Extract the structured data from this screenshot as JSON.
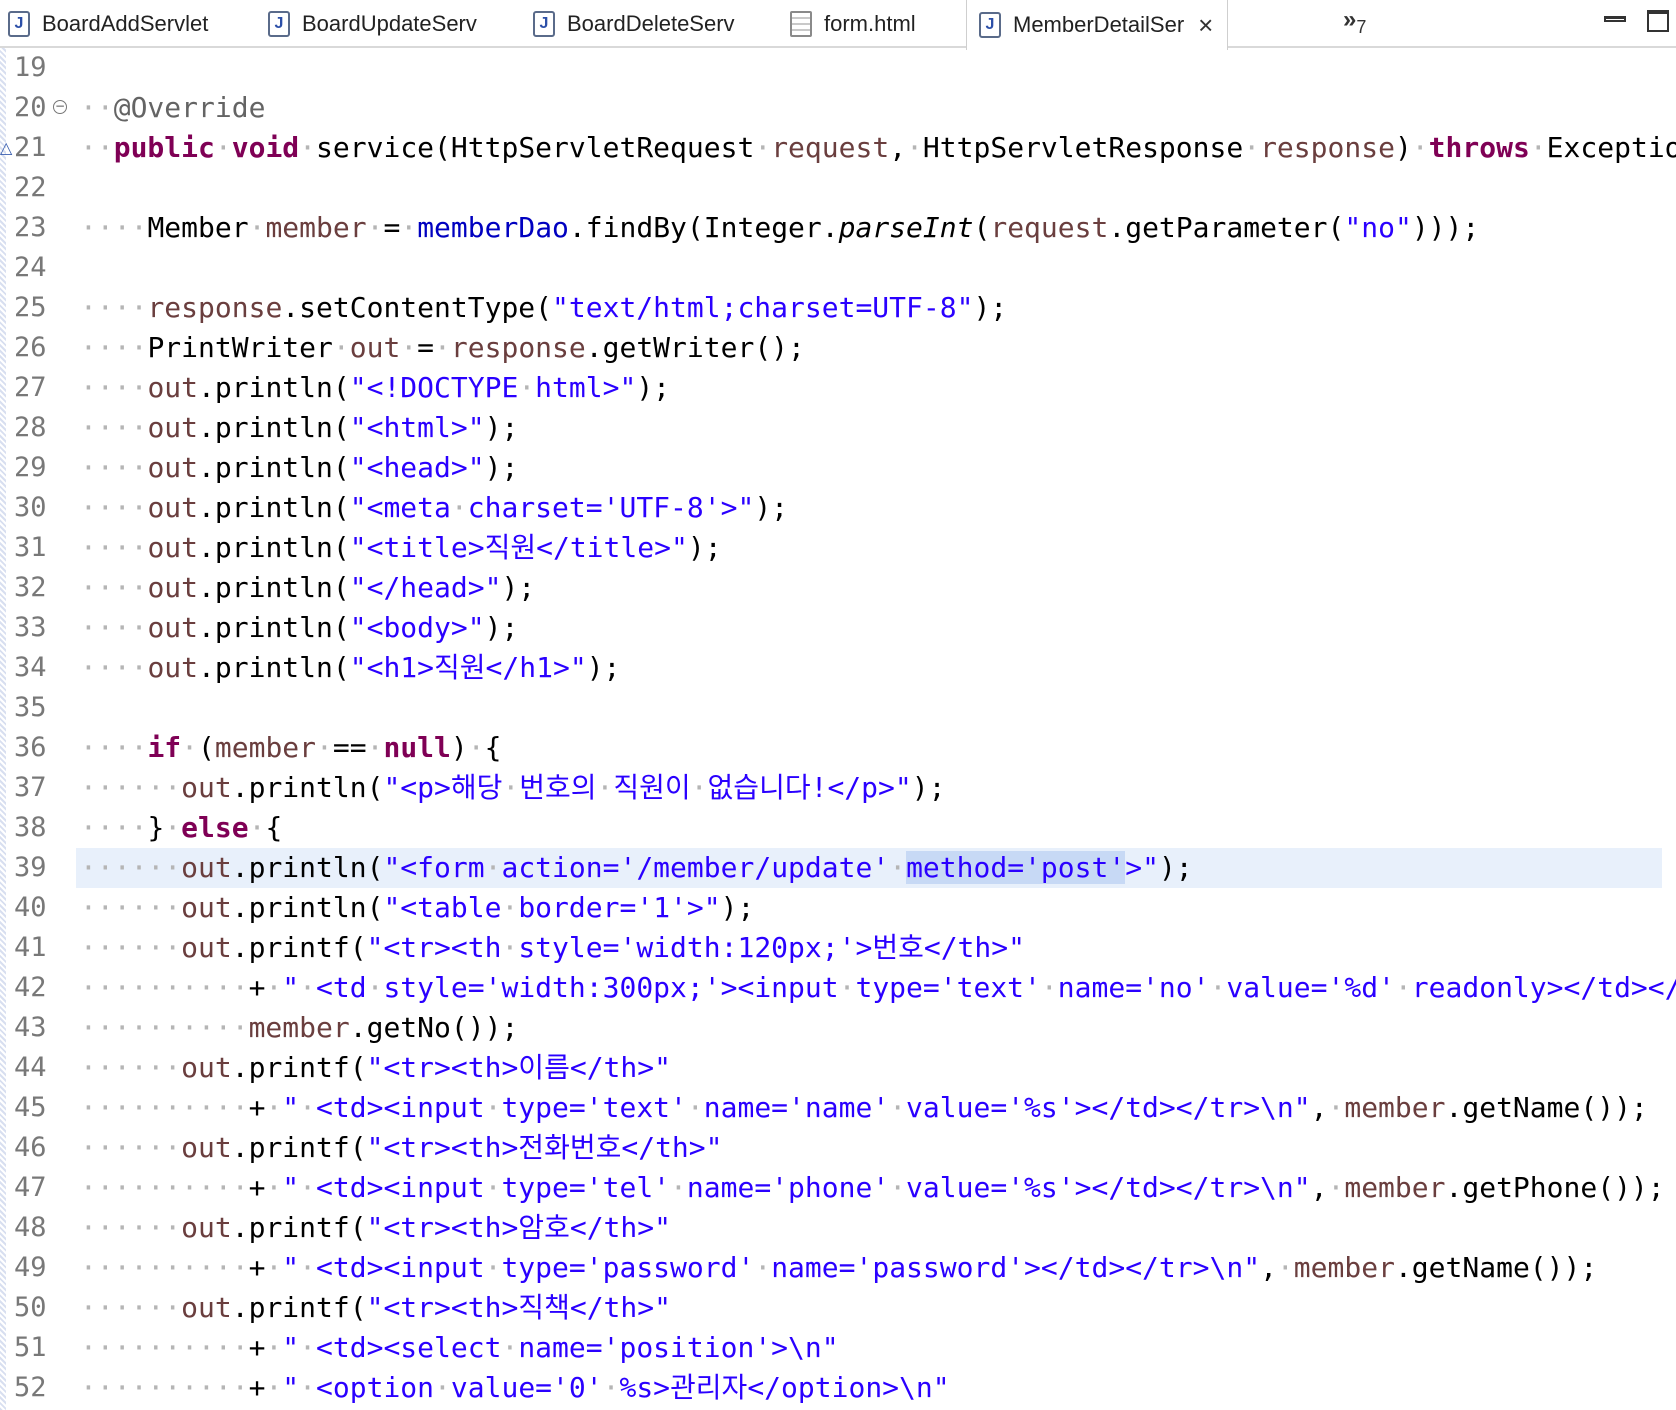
{
  "tabs": [
    {
      "label": "BoardAddServlet",
      "icon": "java-file-icon",
      "active": false
    },
    {
      "label": "BoardUpdateServ",
      "icon": "java-file-icon",
      "active": false
    },
    {
      "label": "BoardDeleteServ",
      "icon": "java-file-icon",
      "active": false
    },
    {
      "label": "form.html",
      "icon": "html-file-icon",
      "active": false
    },
    {
      "label": "MemberDetailSer",
      "icon": "java-file-icon",
      "active": true
    }
  ],
  "tab_overflow": {
    "symbol": "»",
    "count": "7"
  },
  "window_controls": {
    "close_symbol": "×"
  },
  "colors": {
    "keyword": "#7f0055",
    "string": "#2a00ff",
    "field": "#0000c0",
    "local_var": "#6a3e3e",
    "annotation": "#646464",
    "current_line": "#e8f0fb"
  },
  "lines": [
    {
      "n": "19",
      "tokens": []
    },
    {
      "n": "20",
      "tokens": [
        [
          "ws",
          "··"
        ],
        [
          "ann",
          "@Override"
        ]
      ]
    },
    {
      "n": "21",
      "tokens": [
        [
          "ws",
          "··"
        ],
        [
          "kw",
          "public"
        ],
        [
          "ws",
          "·"
        ],
        [
          "kw",
          "void"
        ],
        [
          "ws",
          "·"
        ],
        [
          "p",
          "service(HttpServletRequest"
        ],
        [
          "ws",
          "·"
        ],
        [
          "var",
          "request"
        ],
        [
          "p",
          ","
        ],
        [
          "ws",
          "·"
        ],
        [
          "p",
          "HttpServletResponse"
        ],
        [
          "ws",
          "·"
        ],
        [
          "var",
          "response"
        ],
        [
          "p",
          ")"
        ],
        [
          "ws",
          "·"
        ],
        [
          "kw",
          "throws"
        ],
        [
          "ws",
          "·"
        ],
        [
          "p",
          "Exception"
        ],
        [
          "ws",
          "·"
        ],
        [
          "p",
          "{"
        ]
      ]
    },
    {
      "n": "22",
      "tokens": []
    },
    {
      "n": "23",
      "tokens": [
        [
          "ws",
          "····"
        ],
        [
          "p",
          "Member"
        ],
        [
          "ws",
          "·"
        ],
        [
          "var",
          "member"
        ],
        [
          "ws",
          "·"
        ],
        [
          "p",
          "="
        ],
        [
          "ws",
          "·"
        ],
        [
          "fld",
          "memberDao"
        ],
        [
          "p",
          ".findBy(Integer."
        ],
        [
          "ital",
          "parseInt"
        ],
        [
          "p",
          "("
        ],
        [
          "var",
          "request"
        ],
        [
          "p",
          ".getParameter("
        ],
        [
          "str",
          "\"no\""
        ],
        [
          "p",
          ")));"
        ]
      ]
    },
    {
      "n": "24",
      "tokens": []
    },
    {
      "n": "25",
      "tokens": [
        [
          "ws",
          "····"
        ],
        [
          "var",
          "response"
        ],
        [
          "p",
          ".setContentType("
        ],
        [
          "str",
          "\"text/html;charset=UTF-8\""
        ],
        [
          "p",
          ");"
        ]
      ]
    },
    {
      "n": "26",
      "tokens": [
        [
          "ws",
          "····"
        ],
        [
          "p",
          "PrintWriter"
        ],
        [
          "ws",
          "·"
        ],
        [
          "var",
          "out"
        ],
        [
          "ws",
          "·"
        ],
        [
          "p",
          "="
        ],
        [
          "ws",
          "·"
        ],
        [
          "var",
          "response"
        ],
        [
          "p",
          ".getWriter();"
        ]
      ]
    },
    {
      "n": "27",
      "tokens": [
        [
          "ws",
          "····"
        ],
        [
          "var",
          "out"
        ],
        [
          "p",
          ".println("
        ],
        [
          "str",
          "\"<!DOCTYPE"
        ],
        [
          "ws",
          "·"
        ],
        [
          "str",
          "html>\""
        ],
        [
          "p",
          ");"
        ]
      ]
    },
    {
      "n": "28",
      "tokens": [
        [
          "ws",
          "····"
        ],
        [
          "var",
          "out"
        ],
        [
          "p",
          ".println("
        ],
        [
          "str",
          "\"<html>\""
        ],
        [
          "p",
          ");"
        ]
      ]
    },
    {
      "n": "29",
      "tokens": [
        [
          "ws",
          "····"
        ],
        [
          "var",
          "out"
        ],
        [
          "p",
          ".println("
        ],
        [
          "str",
          "\"<head>\""
        ],
        [
          "p",
          ");"
        ]
      ]
    },
    {
      "n": "30",
      "tokens": [
        [
          "ws",
          "····"
        ],
        [
          "var",
          "out"
        ],
        [
          "p",
          ".println("
        ],
        [
          "str",
          "\"<meta"
        ],
        [
          "ws",
          "·"
        ],
        [
          "str",
          "charset='UTF-8'>\""
        ],
        [
          "p",
          ");"
        ]
      ]
    },
    {
      "n": "31",
      "tokens": [
        [
          "ws",
          "····"
        ],
        [
          "var",
          "out"
        ],
        [
          "p",
          ".println("
        ],
        [
          "str",
          "\"<title>직원</title>\""
        ],
        [
          "p",
          ");"
        ]
      ]
    },
    {
      "n": "32",
      "tokens": [
        [
          "ws",
          "····"
        ],
        [
          "var",
          "out"
        ],
        [
          "p",
          ".println("
        ],
        [
          "str",
          "\"</head>\""
        ],
        [
          "p",
          ");"
        ]
      ]
    },
    {
      "n": "33",
      "tokens": [
        [
          "ws",
          "····"
        ],
        [
          "var",
          "out"
        ],
        [
          "p",
          ".println("
        ],
        [
          "str",
          "\"<body>\""
        ],
        [
          "p",
          ");"
        ]
      ]
    },
    {
      "n": "34",
      "tokens": [
        [
          "ws",
          "····"
        ],
        [
          "var",
          "out"
        ],
        [
          "p",
          ".println("
        ],
        [
          "str",
          "\"<h1>직원</h1>\""
        ],
        [
          "p",
          ");"
        ]
      ]
    },
    {
      "n": "35",
      "tokens": []
    },
    {
      "n": "36",
      "tokens": [
        [
          "ws",
          "····"
        ],
        [
          "kw",
          "if"
        ],
        [
          "ws",
          "·"
        ],
        [
          "p",
          "("
        ],
        [
          "var",
          "member"
        ],
        [
          "ws",
          "·"
        ],
        [
          "p",
          "=="
        ],
        [
          "ws",
          "·"
        ],
        [
          "kw",
          "null"
        ],
        [
          "p",
          ")"
        ],
        [
          "ws",
          "·"
        ],
        [
          "p",
          "{"
        ]
      ]
    },
    {
      "n": "37",
      "tokens": [
        [
          "ws",
          "······"
        ],
        [
          "var",
          "out"
        ],
        [
          "p",
          ".println("
        ],
        [
          "str",
          "\"<p>해당"
        ],
        [
          "ws",
          "·"
        ],
        [
          "str",
          "번호의"
        ],
        [
          "ws",
          "·"
        ],
        [
          "str",
          "직원이"
        ],
        [
          "ws",
          "·"
        ],
        [
          "str",
          "없습니다!</p>\""
        ],
        [
          "p",
          ");"
        ]
      ]
    },
    {
      "n": "38",
      "tokens": [
        [
          "ws",
          "····"
        ],
        [
          "p",
          "}"
        ],
        [
          "ws",
          "·"
        ],
        [
          "kw",
          "else"
        ],
        [
          "ws",
          "·"
        ],
        [
          "p",
          "{"
        ]
      ]
    },
    {
      "n": "39",
      "current": true,
      "tokens": [
        [
          "ws",
          "······"
        ],
        [
          "var",
          "out"
        ],
        [
          "p",
          ".println("
        ],
        [
          "str",
          "\"<form"
        ],
        [
          "ws",
          "·"
        ],
        [
          "str",
          "action='/member/update'"
        ],
        [
          "ws",
          "·"
        ],
        [
          "sel",
          "method='post'"
        ],
        [
          "str",
          ">\""
        ],
        [
          "p",
          ");"
        ]
      ]
    },
    {
      "n": "40",
      "tokens": [
        [
          "ws",
          "······"
        ],
        [
          "var",
          "out"
        ],
        [
          "p",
          ".println("
        ],
        [
          "str",
          "\"<table"
        ],
        [
          "ws",
          "·"
        ],
        [
          "str",
          "border='1'>\""
        ],
        [
          "p",
          ");"
        ]
      ]
    },
    {
      "n": "41",
      "tokens": [
        [
          "ws",
          "······"
        ],
        [
          "var",
          "out"
        ],
        [
          "p",
          ".printf("
        ],
        [
          "str",
          "\"<tr><th"
        ],
        [
          "ws",
          "·"
        ],
        [
          "str",
          "style='width:120px;'>번호</th>\""
        ]
      ]
    },
    {
      "n": "42",
      "tokens": [
        [
          "ws",
          "··········"
        ],
        [
          "p",
          "+"
        ],
        [
          "ws",
          "·"
        ],
        [
          "str",
          "\""
        ],
        [
          "ws",
          "·"
        ],
        [
          "str",
          "<td"
        ],
        [
          "ws",
          "·"
        ],
        [
          "str",
          "style='width:300px;'><input"
        ],
        [
          "ws",
          "·"
        ],
        [
          "str",
          "type='text'"
        ],
        [
          "ws",
          "·"
        ],
        [
          "str",
          "name='no'"
        ],
        [
          "ws",
          "·"
        ],
        [
          "str",
          "value='%d'"
        ],
        [
          "ws",
          "·"
        ],
        [
          "str",
          "readonly></td></tr>\\"
        ]
      ]
    },
    {
      "n": "43",
      "tokens": [
        [
          "ws",
          "··········"
        ],
        [
          "var",
          "member"
        ],
        [
          "p",
          ".getNo());"
        ]
      ]
    },
    {
      "n": "44",
      "tokens": [
        [
          "ws",
          "······"
        ],
        [
          "var",
          "out"
        ],
        [
          "p",
          ".printf("
        ],
        [
          "str",
          "\"<tr><th>이름</th>\""
        ]
      ]
    },
    {
      "n": "45",
      "tokens": [
        [
          "ws",
          "··········"
        ],
        [
          "p",
          "+"
        ],
        [
          "ws",
          "·"
        ],
        [
          "str",
          "\""
        ],
        [
          "ws",
          "·"
        ],
        [
          "str",
          "<td><input"
        ],
        [
          "ws",
          "·"
        ],
        [
          "str",
          "type='text'"
        ],
        [
          "ws",
          "·"
        ],
        [
          "str",
          "name='name'"
        ],
        [
          "ws",
          "·"
        ],
        [
          "str",
          "value='%s'></td></tr>\\n\""
        ],
        [
          "p",
          ","
        ],
        [
          "ws",
          "·"
        ],
        [
          "var",
          "member"
        ],
        [
          "p",
          ".getName());"
        ]
      ]
    },
    {
      "n": "46",
      "tokens": [
        [
          "ws",
          "······"
        ],
        [
          "var",
          "out"
        ],
        [
          "p",
          ".printf("
        ],
        [
          "str",
          "\"<tr><th>전화번호</th>\""
        ]
      ]
    },
    {
      "n": "47",
      "tokens": [
        [
          "ws",
          "··········"
        ],
        [
          "p",
          "+"
        ],
        [
          "ws",
          "·"
        ],
        [
          "str",
          "\""
        ],
        [
          "ws",
          "·"
        ],
        [
          "str",
          "<td><input"
        ],
        [
          "ws",
          "·"
        ],
        [
          "str",
          "type='tel'"
        ],
        [
          "ws",
          "·"
        ],
        [
          "str",
          "name='phone'"
        ],
        [
          "ws",
          "·"
        ],
        [
          "str",
          "value='%s'></td></tr>\\n\""
        ],
        [
          "p",
          ","
        ],
        [
          "ws",
          "·"
        ],
        [
          "var",
          "member"
        ],
        [
          "p",
          ".getPhone());"
        ]
      ]
    },
    {
      "n": "48",
      "tokens": [
        [
          "ws",
          "······"
        ],
        [
          "var",
          "out"
        ],
        [
          "p",
          ".printf("
        ],
        [
          "str",
          "\"<tr><th>암호</th>\""
        ]
      ]
    },
    {
      "n": "49",
      "tokens": [
        [
          "ws",
          "··········"
        ],
        [
          "p",
          "+"
        ],
        [
          "ws",
          "·"
        ],
        [
          "str",
          "\""
        ],
        [
          "ws",
          "·"
        ],
        [
          "str",
          "<td><input"
        ],
        [
          "ws",
          "·"
        ],
        [
          "str",
          "type='password'"
        ],
        [
          "ws",
          "·"
        ],
        [
          "str",
          "name='password'></td></tr>\\n\""
        ],
        [
          "p",
          ","
        ],
        [
          "ws",
          "·"
        ],
        [
          "var",
          "member"
        ],
        [
          "p",
          ".getName());"
        ]
      ]
    },
    {
      "n": "50",
      "tokens": [
        [
          "ws",
          "······"
        ],
        [
          "var",
          "out"
        ],
        [
          "p",
          ".printf("
        ],
        [
          "str",
          "\"<tr><th>직책</th>\""
        ]
      ]
    },
    {
      "n": "51",
      "tokens": [
        [
          "ws",
          "··········"
        ],
        [
          "p",
          "+"
        ],
        [
          "ws",
          "·"
        ],
        [
          "str",
          "\""
        ],
        [
          "ws",
          "·"
        ],
        [
          "str",
          "<td><select"
        ],
        [
          "ws",
          "·"
        ],
        [
          "str",
          "name='position'>\\n\""
        ]
      ]
    },
    {
      "n": "52",
      "tokens": [
        [
          "ws",
          "··········"
        ],
        [
          "p",
          "+"
        ],
        [
          "ws",
          "·"
        ],
        [
          "str",
          "\""
        ],
        [
          "ws",
          "·"
        ],
        [
          "str",
          "<option"
        ],
        [
          "ws",
          "·"
        ],
        [
          "str",
          "value='0'"
        ],
        [
          "ws",
          "·"
        ],
        [
          "str",
          "%s>관리자</option>\\n\""
        ]
      ]
    }
  ]
}
